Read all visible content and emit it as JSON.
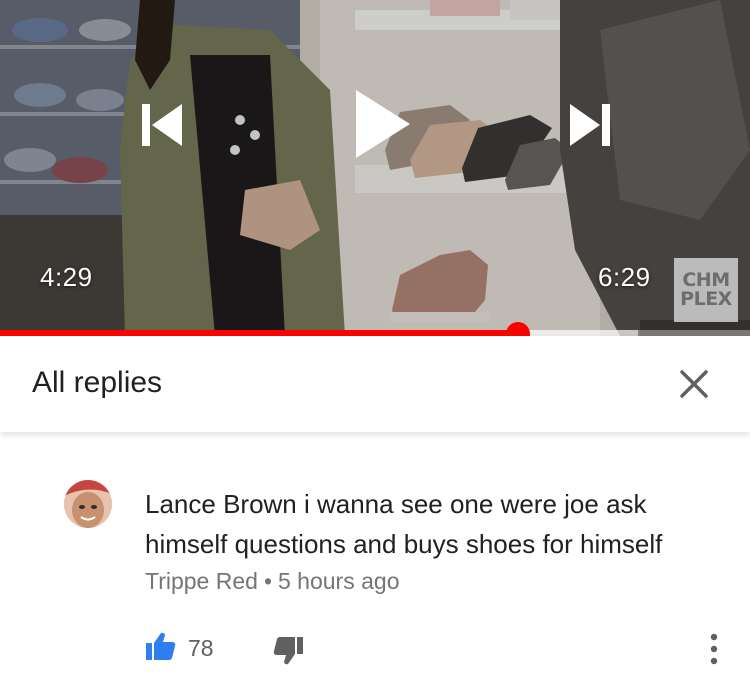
{
  "player": {
    "current_time": "4:29",
    "duration": "6:29",
    "progress_fraction": 0.69,
    "buffered_fraction": 0.85,
    "accent_color": "#ff0000",
    "controls": {
      "previous_icon": "skip-previous-icon",
      "play_icon": "play-icon",
      "next_icon": "skip-next-icon"
    },
    "watermark": {
      "line1": "CHM",
      "line2": "PLEX"
    }
  },
  "replies_panel": {
    "title": "All replies",
    "close_icon": "close-icon"
  },
  "comment": {
    "avatar_icon": "user-avatar",
    "text": "Lance Brown i wanna see one were joe ask himself questions and buys shoes for himself",
    "author": "Trippe Red",
    "separator": "•",
    "time_ago": "5 hours ago",
    "like_count": "78",
    "like_icon": "thumbs-up-icon",
    "dislike_icon": "thumbs-down-icon",
    "more_icon": "more-vert-icon",
    "like_color": "#2e7ef2"
  }
}
